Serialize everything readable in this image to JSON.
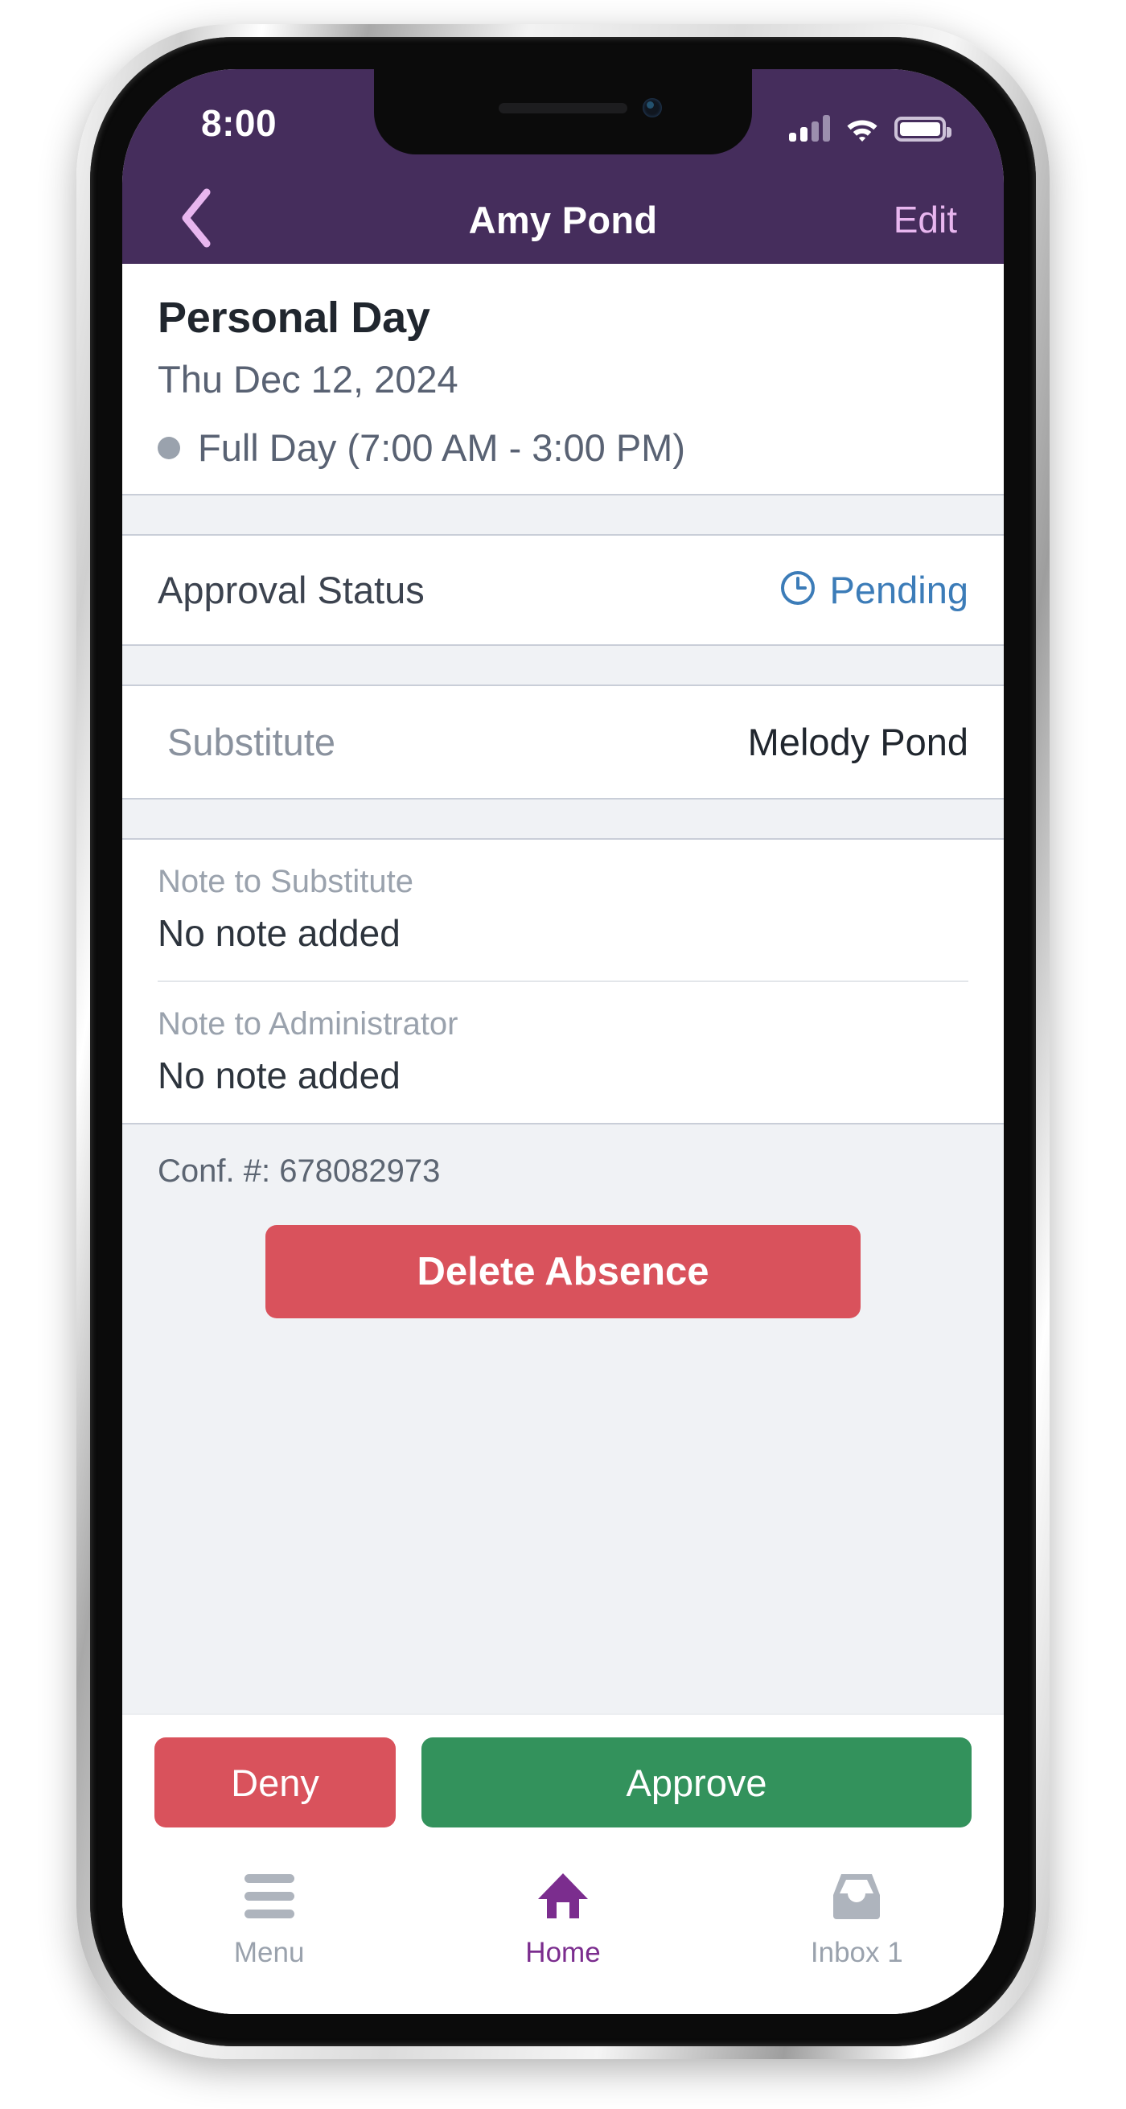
{
  "status_bar": {
    "time": "8:00",
    "signal_icon": "signal-bars-icon",
    "wifi_icon": "wifi-icon",
    "battery_icon": "battery-icon"
  },
  "nav_bar": {
    "back_icon": "chevron-left-icon",
    "title": "Amy Pond",
    "edit_label": "Edit"
  },
  "absence": {
    "type": "Personal Day",
    "date": "Thu Dec 12, 2024",
    "duration": "Full Day (7:00 AM - 3:00 PM)",
    "duration_dot_color": "#9aa2ad"
  },
  "approval": {
    "label": "Approval Status",
    "status": "Pending",
    "status_icon": "clock-icon",
    "status_color": "#3c7cb8"
  },
  "substitute": {
    "label": "Substitute",
    "name": "Melody Pond"
  },
  "notes": [
    {
      "label": "Note to Substitute",
      "value": "No note added"
    },
    {
      "label": "Note to Administrator",
      "value": "No note added"
    }
  ],
  "confirmation": {
    "number_label": "Conf. #: 678082973",
    "delete_label": "Delete Absence",
    "delete_color": "#d9525c"
  },
  "actions": {
    "deny_label": "Deny",
    "deny_color": "#d9525c",
    "approve_label": "Approve",
    "approve_color": "#33925c"
  },
  "tab_bar": {
    "items": [
      {
        "label": "Menu",
        "icon": "hamburger-menu-icon",
        "active": false
      },
      {
        "label": "Home",
        "icon": "home-icon",
        "active": true
      },
      {
        "label": "Inbox 1",
        "icon": "inbox-icon",
        "active": false
      }
    ],
    "active_color": "#7b2d8e",
    "inactive_color": "#9aa2ad"
  },
  "theme": {
    "header_purple": "#452d5c",
    "edit_pink": "#e8b6ef",
    "band_gray": "#f0f2f5"
  }
}
